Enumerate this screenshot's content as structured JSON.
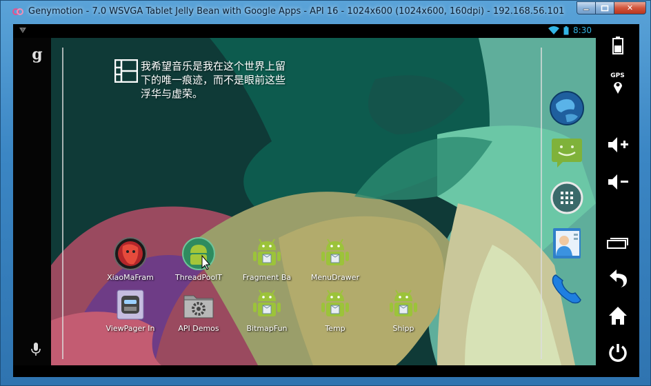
{
  "window": {
    "title": "Genymotion - 7.0 WSVGA Tablet Jelly Bean with Google Apps - API 16 - 1024x600 (1024x600, 160dpi) - 192.168.56.101",
    "controls": {
      "minimize": "",
      "maximize": "",
      "close": "✕"
    }
  },
  "status_bar": {
    "time": "8:30",
    "icons": [
      "help-icon",
      "wifi-icon",
      "battery-icon"
    ]
  },
  "home": {
    "search_glyph": "g",
    "widget_text": "我希望音乐是我在这个世界上留下的唯一痕迹，而不是眼前这些浮华与虚荣。",
    "apps_row1": [
      {
        "label": "XiaoMaFram",
        "icon": "xiaoma-app-icon"
      },
      {
        "label": "ThreadPoolT",
        "icon": "android-app-icon"
      },
      {
        "label": "Fragment Ba",
        "icon": "android-app-icon"
      },
      {
        "label": "MenuDrawer",
        "icon": "android-app-icon"
      }
    ],
    "apps_row2": [
      {
        "label": "ViewPager In",
        "icon": "robot-app-icon"
      },
      {
        "label": "API Demos",
        "icon": "settings-folder-icon"
      },
      {
        "label": "BitmapFun",
        "icon": "android-app-icon"
      },
      {
        "label": "Temp",
        "icon": "android-app-icon"
      },
      {
        "label": "Shipp",
        "icon": "android-app-icon"
      }
    ],
    "dock": [
      "browser-globe-icon",
      "messaging-icon",
      "all-apps-icon",
      "contacts-icon",
      "phone-icon"
    ]
  },
  "control_panel": {
    "gps_label": "GPS",
    "buttons": [
      "battery-icon",
      "gps-icon",
      "volume-up-icon",
      "volume-down-icon",
      "recent-apps-icon",
      "back-icon",
      "home-icon",
      "power-icon"
    ]
  },
  "colors": {
    "accent_time": "#33b5e5",
    "android_green": "#a4c639"
  }
}
